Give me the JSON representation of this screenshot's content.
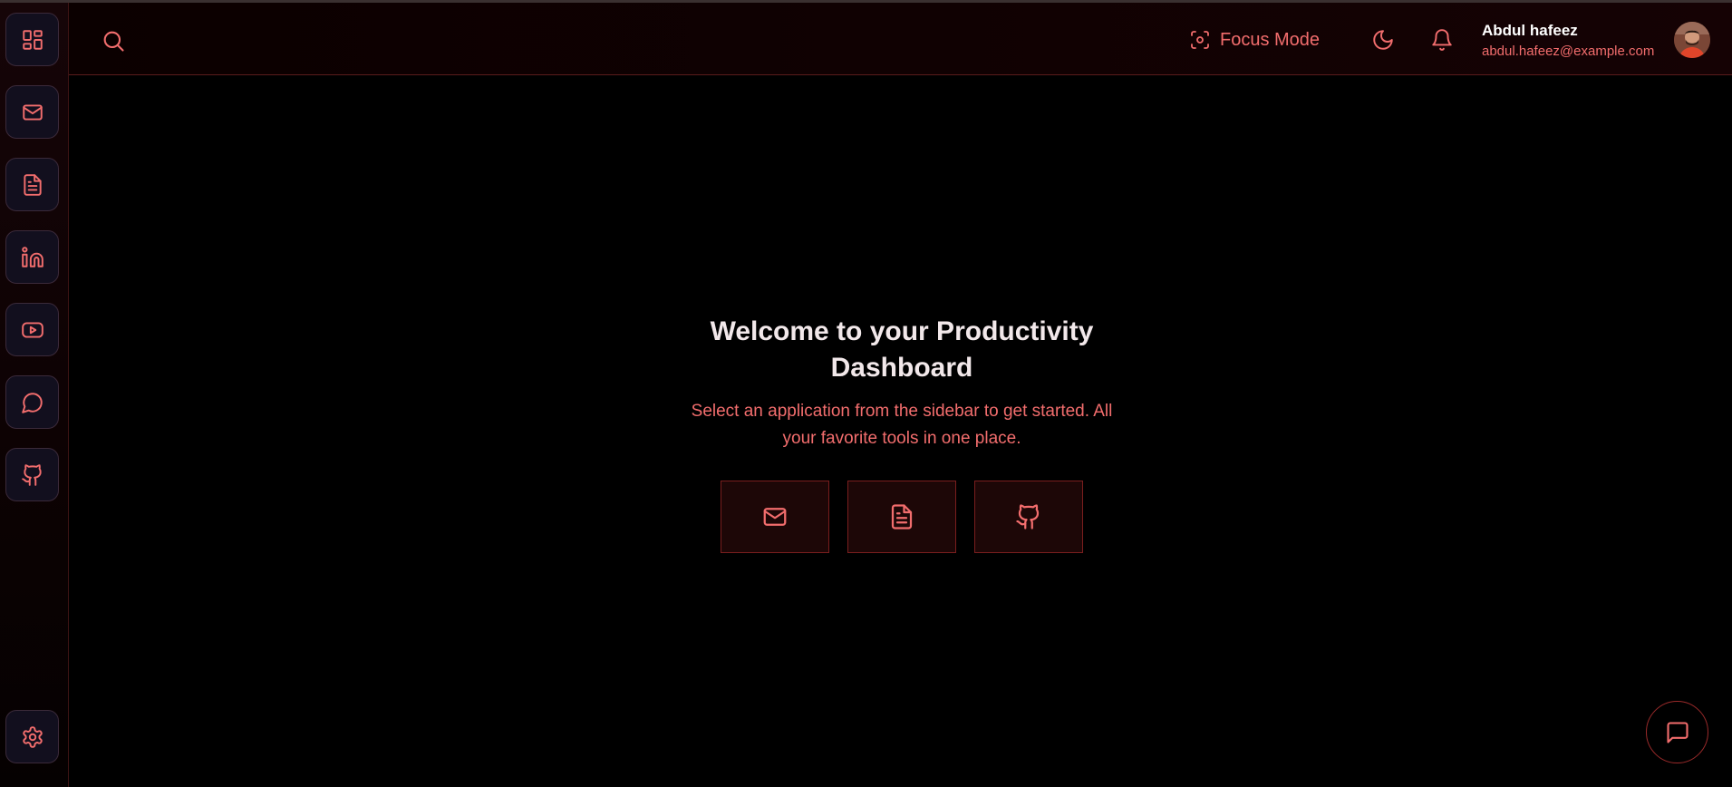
{
  "topbar": {
    "focus_mode_label": "Focus Mode",
    "user": {
      "name": "Abdul hafeez",
      "email": "abdul.hafeez@example.com"
    }
  },
  "sidebar": {
    "items": [
      {
        "icon": "dashboard-grid-icon"
      },
      {
        "icon": "mail-icon"
      },
      {
        "icon": "document-icon"
      },
      {
        "icon": "linkedin-icon"
      },
      {
        "icon": "youtube-icon"
      },
      {
        "icon": "chat-icon"
      },
      {
        "icon": "github-icon"
      }
    ],
    "settings_icon": "gear-icon"
  },
  "main": {
    "title": "Welcome to your Productivity Dashboard",
    "subtitle": "Select an application from the sidebar to get started. All your favorite tools in one place.",
    "quick_launch": [
      {
        "icon": "mail-icon"
      },
      {
        "icon": "document-icon"
      },
      {
        "icon": "github-icon"
      }
    ]
  },
  "colors": {
    "accent": "#f26d6d",
    "background": "#000000",
    "title": "#f2e8ea",
    "sidebar_button_bg": "#120f1e"
  }
}
